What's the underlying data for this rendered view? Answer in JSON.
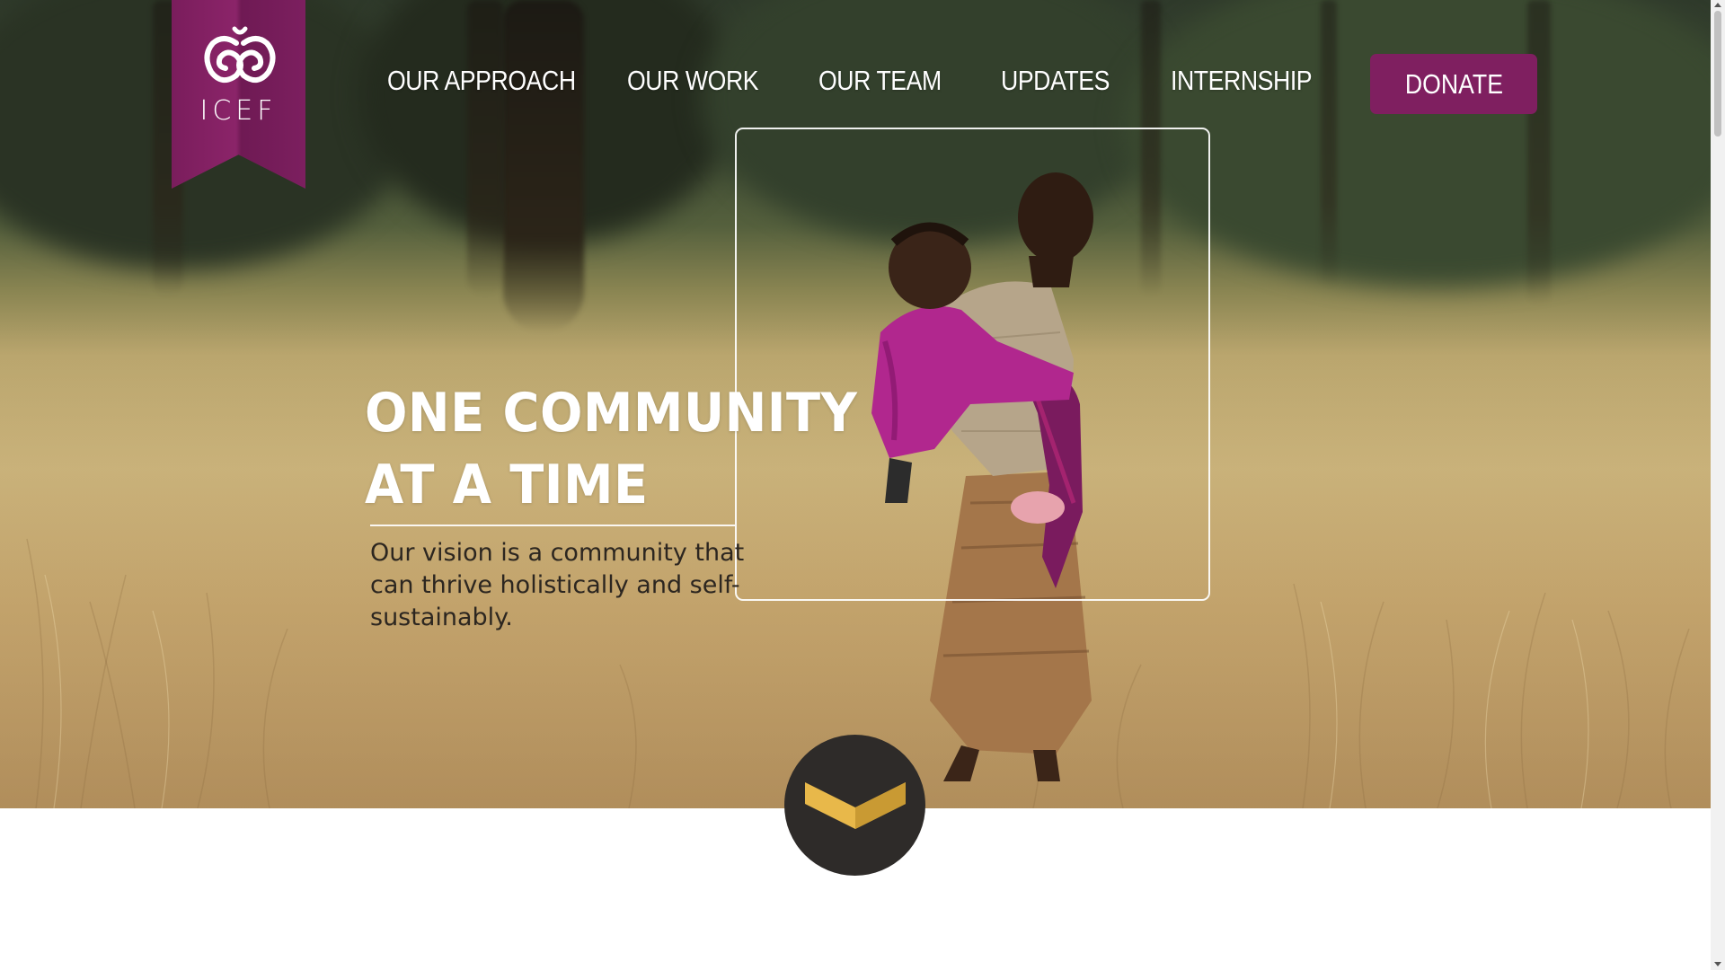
{
  "logo": {
    "text": "ICEF",
    "icon": "icef-swirl-logo-icon",
    "color": "#7f1f60"
  },
  "nav": {
    "items": [
      {
        "label": "OUR APPROACH"
      },
      {
        "label": "OUR WORK"
      },
      {
        "label": "OUR TEAM"
      },
      {
        "label": "UPDATES"
      },
      {
        "label": "INTERNSHIP"
      }
    ],
    "donate_label": "DONATE"
  },
  "hero": {
    "headline_line1": "ONE COMMUNITY",
    "headline_line2": "AT A TIME",
    "tagline": "Our vision is a community that can thrive holistically and self-sustainably.",
    "scroll_icon": "chevron-down-icon",
    "accent": "#e8b84a"
  }
}
